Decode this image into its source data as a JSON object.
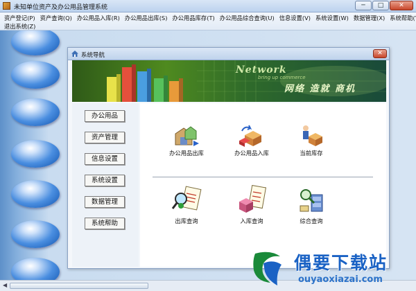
{
  "window": {
    "title": "未知单位资产及办公用品管理系统",
    "minimize_label": "─",
    "maximize_label": "□",
    "close_label": "✕"
  },
  "menu": {
    "row1": [
      "资产登记(P)",
      "资产查询(Q)",
      "办公用品入库(R)",
      "办公用品出库(S)",
      "办公用品库存(T)",
      "办公用品综合查询(U)",
      "信息设置(V)",
      "系统设置(W)",
      "数据管理(X)",
      "系统帮助(Y)"
    ],
    "row2": [
      "退出系统(Z)"
    ]
  },
  "child_window": {
    "title": "系统导航",
    "close_label": "✕"
  },
  "banner": {
    "word1": "Network",
    "word2": "bring up commerce",
    "slogan": "网络 造就 商机"
  },
  "nav": {
    "items": [
      "办公用品",
      "资产管理",
      "信息设置",
      "系统设置",
      "数据管理",
      "系统帮助"
    ]
  },
  "tiles": {
    "outbound": "办公用品出库",
    "inbound": "办公用品入库",
    "stock": "当前库存",
    "outbound_query": "出库查询",
    "inbound_query": "入库查询",
    "combined_query": "综合查询"
  },
  "watermark": {
    "text": "偶要下载站",
    "url": "ouyaoxiazai.com"
  },
  "colors": {
    "accent": "#1a62c4",
    "banner": "#4f8a1f",
    "bubble": "#4a8ee0"
  }
}
